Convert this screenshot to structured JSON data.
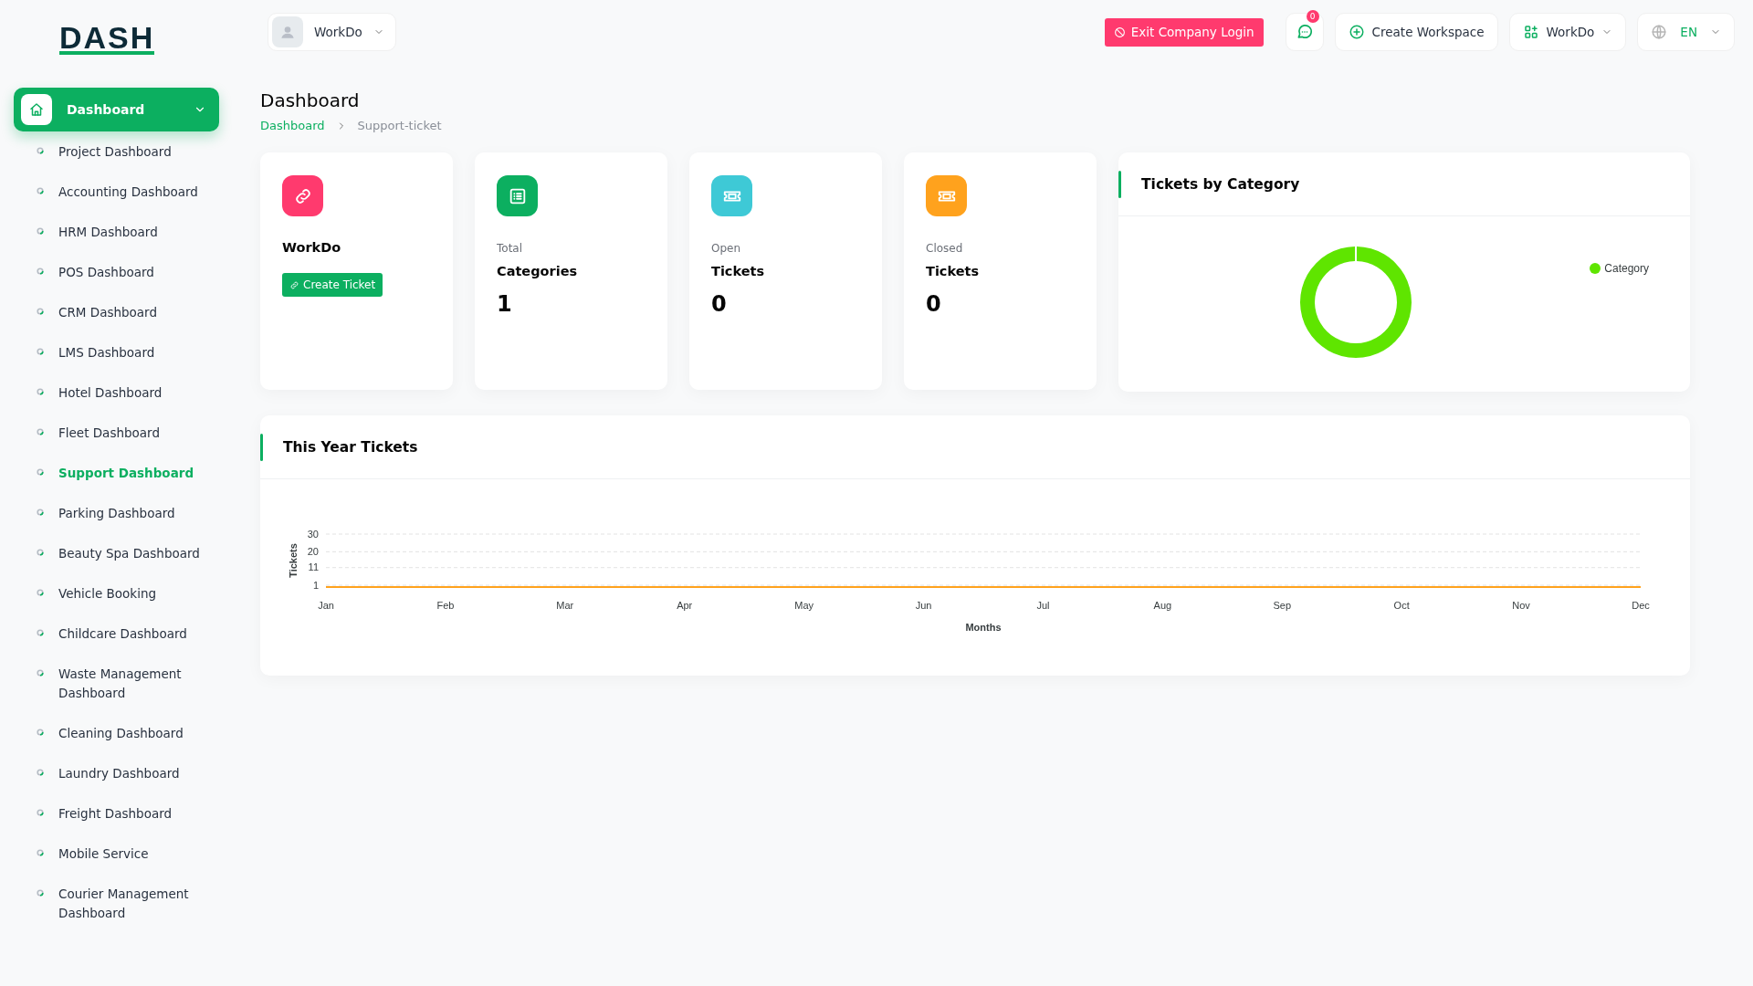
{
  "logo": {
    "text": "DASH"
  },
  "header": {
    "user_menu": {
      "label": "WorkDo"
    },
    "exit_button": {
      "label": "Exit Company Login"
    },
    "messages": {
      "badge": "0"
    },
    "create_workspace": {
      "label": "Create Workspace"
    },
    "workspace_menu": {
      "label": "WorkDo"
    },
    "language_menu": {
      "label": "EN"
    }
  },
  "sidebar": {
    "items": [
      {
        "label": "Dashboard",
        "kind": "main",
        "selected": true,
        "expanded": true
      },
      {
        "label": "Project Dashboard",
        "kind": "sub",
        "selected": false
      },
      {
        "label": "Accounting Dashboard",
        "kind": "sub",
        "selected": false
      },
      {
        "label": "HRM Dashboard",
        "kind": "sub",
        "selected": false
      },
      {
        "label": "POS Dashboard",
        "kind": "sub",
        "selected": false
      },
      {
        "label": "CRM Dashboard",
        "kind": "sub",
        "selected": false
      },
      {
        "label": "LMS Dashboard",
        "kind": "sub",
        "selected": false
      },
      {
        "label": "Hotel Dashboard",
        "kind": "sub",
        "selected": false
      },
      {
        "label": "Fleet Dashboard",
        "kind": "sub",
        "selected": false
      },
      {
        "label": "Support Dashboard",
        "kind": "sub",
        "selected": true
      },
      {
        "label": "Parking Dashboard",
        "kind": "sub",
        "selected": false
      },
      {
        "label": "Beauty Spa Dashboard",
        "kind": "sub",
        "selected": false
      },
      {
        "label": "Vehicle Booking",
        "kind": "sub",
        "selected": false
      },
      {
        "label": "Childcare Dashboard",
        "kind": "sub",
        "selected": false
      },
      {
        "label": "Waste Management Dashboard",
        "kind": "sub",
        "selected": false
      },
      {
        "label": "Cleaning Dashboard",
        "kind": "sub",
        "selected": false
      },
      {
        "label": "Laundry Dashboard",
        "kind": "sub",
        "selected": false
      },
      {
        "label": "Freight Dashboard",
        "kind": "sub",
        "selected": false
      },
      {
        "label": "Mobile Service",
        "kind": "sub",
        "selected": false
      },
      {
        "label": "Courier Management Dashboard",
        "kind": "sub",
        "selected": false
      }
    ]
  },
  "page": {
    "title": "Dashboard",
    "breadcrumb": [
      {
        "label": "Dashboard",
        "kind": "link"
      },
      {
        "label": "Support-ticket",
        "kind": "current"
      }
    ]
  },
  "stat_cards": [
    {
      "kind": "company",
      "title": "WorkDo",
      "button": "Create Ticket"
    },
    {
      "kind": "stat",
      "caption": "Total",
      "title": "Categories",
      "value": "1"
    },
    {
      "kind": "stat",
      "caption": "Open",
      "title": "Tickets",
      "value": "0"
    },
    {
      "kind": "stat",
      "caption": "Closed",
      "title": "Tickets",
      "value": "0"
    }
  ],
  "category_chart": {
    "title": "Tickets by Category",
    "legend": [
      {
        "label": "Category",
        "color": "#5fe500"
      }
    ]
  },
  "year_chart": {
    "title": "This Year Tickets",
    "chart_data": {
      "type": "line",
      "xlabel": "Months",
      "ylabel": "Tickets",
      "categories": [
        "Jan",
        "Feb",
        "Mar",
        "Apr",
        "May",
        "Jun",
        "Jul",
        "Aug",
        "Sep",
        "Oct",
        "Nov",
        "Dec"
      ],
      "series": [
        {
          "color": "#ffa21d",
          "values": [
            0,
            0,
            0,
            0,
            0,
            0,
            0,
            0,
            0,
            0,
            0,
            0
          ]
        }
      ],
      "ylim": [
        0,
        30
      ],
      "yticks": [
        1,
        11,
        20,
        30
      ]
    }
  }
}
